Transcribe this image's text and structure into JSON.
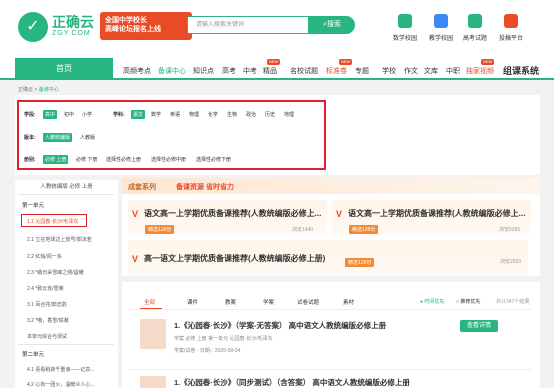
{
  "header": {
    "logo_cn": "正确云",
    "logo_en": "ZGY.COM",
    "promo_line1": "全国中学校长",
    "promo_line2": "高峰论坛报名上线",
    "promo_badge": "HOT",
    "search_placeholder": "请输入搜索关键词",
    "search_button": "搜索",
    "tools": [
      "数学校园",
      "教学校园",
      "高考试题",
      "投稿平台"
    ]
  },
  "nav": {
    "home": "首页",
    "items": [
      "高频考点",
      "备课中心",
      "知识点",
      "高考",
      "中考",
      "精品",
      "名校试题",
      "标准卷",
      "专题",
      "学校",
      "作文",
      "文库",
      "中职",
      "独家视频",
      "组课系统"
    ],
    "new_badge": "NEW"
  },
  "breadcrumb": {
    "root": "正确云",
    "sep": ">",
    "current": "备课中心"
  },
  "filter": {
    "row1": {
      "label": "学段:",
      "options": [
        "高中",
        "初中",
        "小学"
      ],
      "subject_label": "学科:",
      "subjects": [
        "语文",
        "数学",
        "英语",
        "物理",
        "化学",
        "生物",
        "政治",
        "历史",
        "地理"
      ]
    },
    "row2": {
      "label": "版本:",
      "options": [
        "人教统编版",
        "人教版"
      ]
    },
    "row3": {
      "label": "册别:",
      "options": [
        "必修 上册",
        "必修 下册",
        "选择性必修上册",
        "选择性必修中册",
        "选择性必修下册"
      ]
    }
  },
  "sidebar": {
    "title": "人教统编版 必修 上册",
    "unit1": "第一单元",
    "items1": [
      "1.1 沁园春·长沙/毛泽东",
      "2.1 立在地球边上放号/郭沫若",
      "2.2 红烛/闻一多",
      "2.3 *峨日朵雪峰之侧/昌耀",
      "2.4 *致云雀/雪莱",
      "3.1 百合花/茹志鹃",
      "3.2 *哦，香雪/铁凝",
      "本单元综合与测试"
    ],
    "unit2": "第二单元",
    "items2": [
      "4.1 喜看稻菽千重浪——记袁...",
      "4.2 心有一团火，温暖众人心..."
    ]
  },
  "recommend": {
    "title": "成套系列",
    "subtitle": "备课资源 省时省力",
    "cards": [
      {
        "name": "语文高一上学期优质备课推荐(人教统编版必修上...",
        "tag": "精选128份",
        "views": "浏览1440"
      },
      {
        "name": "语文高一上学期优质备课推荐(人教统编版必修上...",
        "tag": "精选128份",
        "views": "浏览5395"
      },
      {
        "name": "高一语文上学期优质备课推荐(人教统编版必修上册)",
        "tag": "精选128份",
        "views": "浏览2933"
      }
    ]
  },
  "list": {
    "tabs": [
      "全部",
      "课件",
      "教案",
      "学案",
      "试卷试题",
      "素材"
    ],
    "sort": [
      "时间优先",
      "推荐优先"
    ],
    "count": "共计347个结果",
    "items": [
      {
        "title": "1.《沁园春·长沙》（学案-无答案） 高中语文人教统编版必修上册",
        "meta": "学案 必修 上册  第一单元  沁园春·长沙/毛泽东",
        "meta2": "学案/试卷 · 日期：2025-09-04",
        "button": "查看详情"
      },
      {
        "title": "1.《沁园春·长沙》（同步测试）（含答案） 高中语文人教统编版必修上册"
      }
    ]
  },
  "colors": {
    "brand": "#27b67f",
    "accent": "#e94b27",
    "outline": "#e0202a"
  }
}
